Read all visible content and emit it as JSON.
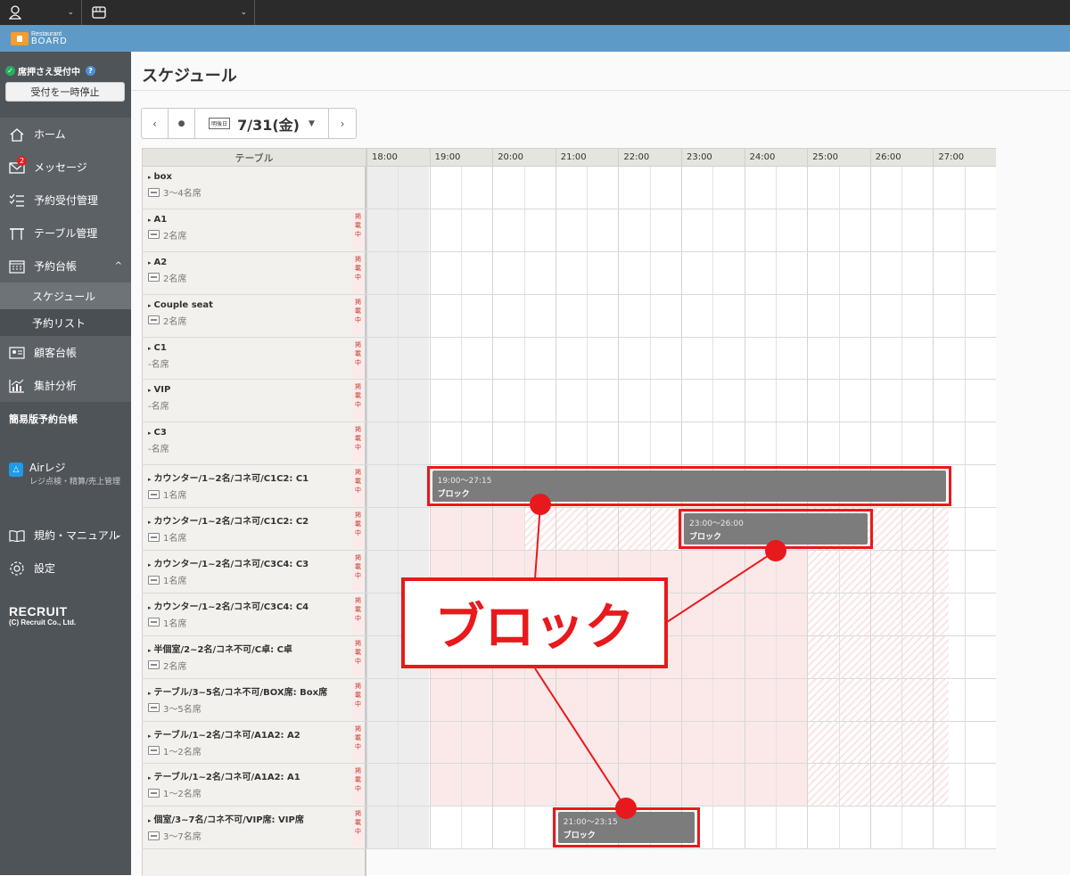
{
  "topbar": {
    "store_selector_chev": "⌄",
    "user_chev": "⌄"
  },
  "brand": {
    "line1": "Restaurant",
    "line2": "BOARD"
  },
  "sidebar": {
    "status_label": "席押さえ受付中",
    "status_help": "?",
    "pause_button": "受付を一時停止",
    "nav": [
      {
        "label": "ホーム",
        "icon": "home-icon"
      },
      {
        "label": "メッセージ",
        "icon": "mail-icon",
        "badge": "2"
      },
      {
        "label": "予約受付管理",
        "icon": "list-check-icon"
      },
      {
        "label": "テーブル管理",
        "icon": "table-icon"
      },
      {
        "label": "予約台帳",
        "icon": "calendar-icon",
        "caret": "^"
      }
    ],
    "sub": [
      {
        "label": "スケジュール",
        "active": true
      },
      {
        "label": "予約リスト",
        "active": false
      }
    ],
    "nav2": [
      {
        "label": "顧客台帳",
        "icon": "id-card-icon"
      },
      {
        "label": "集計分析",
        "icon": "chart-icon"
      }
    ],
    "simple_ledger": "簡易版予約台帳",
    "airreji": {
      "title": "Airレジ",
      "subtitle": "レジ点検・精算/売上管理"
    },
    "rules": {
      "label": "規約・マニュアル",
      "caret": "⌄"
    },
    "settings": {
      "label": "設定"
    },
    "recruit": {
      "logo": "RECRUIT",
      "copyright": "(C) Recruit Co., Ltd."
    }
  },
  "main": {
    "title": "スケジュール",
    "date_nav": {
      "prev": "‹",
      "today": "●",
      "tag": "明後日",
      "date": "7/31(金)",
      "dropdown": "▼",
      "next": "›"
    },
    "table_header": "テーブル",
    "hours": [
      "18:00",
      "19:00",
      "20:00",
      "21:00",
      "22:00",
      "23:00",
      "24:00",
      "25:00",
      "26:00",
      "27:00"
    ],
    "publish_label": "掲載中",
    "rows": [
      {
        "name": "box",
        "cap": "3〜4名席",
        "icon": true,
        "pub": false
      },
      {
        "name": "A1",
        "cap": "2名席",
        "icon": true,
        "pub": true
      },
      {
        "name": "A2",
        "cap": "2名席",
        "icon": true,
        "pub": true
      },
      {
        "name": "Couple seat",
        "cap": "2名席",
        "icon": true,
        "pub": true
      },
      {
        "name": "C1",
        "cap": "-名席",
        "icon": false,
        "pub": true
      },
      {
        "name": "VIP",
        "cap": "-名席",
        "icon": false,
        "pub": true
      },
      {
        "name": "C3",
        "cap": "-名席",
        "icon": false,
        "pub": true
      },
      {
        "name": "カウンター/1~2名/コネ可/C1C2: C1",
        "cap": "1名席",
        "icon": true,
        "pub": true
      },
      {
        "name": "カウンター/1~2名/コネ可/C1C2: C2",
        "cap": "1名席",
        "icon": true,
        "pub": true
      },
      {
        "name": "カウンター/1~2名/コネ可/C3C4: C3",
        "cap": "1名席",
        "icon": true,
        "pub": true
      },
      {
        "name": "カウンター/1~2名/コネ可/C3C4: C4",
        "cap": "1名席",
        "icon": true,
        "pub": true
      },
      {
        "name": "半個室/2~2名/コネ不可/C卓: C卓",
        "cap": "2名席",
        "icon": true,
        "pub": true
      },
      {
        "name": "テーブル/3~5名/コネ不可/BOX席: Box席",
        "cap": "3〜5名席",
        "icon": true,
        "pub": true
      },
      {
        "name": "テーブル/1~2名/コネ可/A1A2: A2",
        "cap": "1〜2名席",
        "icon": true,
        "pub": true
      },
      {
        "name": "テーブル/1~2名/コネ可/A1A2: A1",
        "cap": "1〜2名席",
        "icon": true,
        "pub": true
      },
      {
        "name": "個室/3~7名/コネ不可/VIP席: VIP席",
        "cap": "3〜7名席",
        "icon": true,
        "pub": true
      }
    ],
    "blocks": [
      {
        "row": 7,
        "start": "19:00",
        "end": "27:15",
        "time": "19:00〜27:15",
        "label": "ブロック"
      },
      {
        "row": 8,
        "start": "23:00",
        "end": "26:00",
        "time": "23:00〜26:00",
        "label": "ブロック"
      },
      {
        "row": 15,
        "start": "21:00",
        "end": "23:15",
        "time": "21:00〜23:15",
        "label": "ブロック"
      }
    ]
  },
  "annotation": {
    "callout": "ブロック",
    "color": "#e8191c"
  }
}
